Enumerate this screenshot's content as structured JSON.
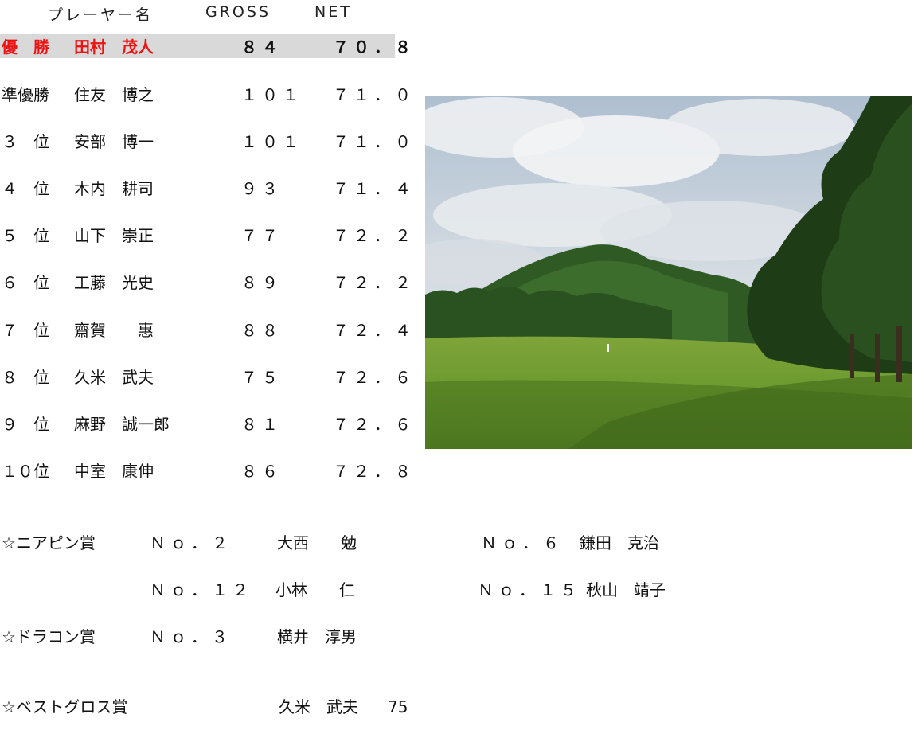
{
  "header": {
    "player": "プレーヤー名",
    "gross": "GROSS",
    "net": "NET"
  },
  "standings": [
    {
      "rank": "優　勝",
      "name": "田村　茂人",
      "gross": "８４",
      "net": "７０．８"
    },
    {
      "rank": "準優勝",
      "name": "住友　博之",
      "gross": "１０１",
      "net": "７１．０"
    },
    {
      "rank": "３　位",
      "name": "安部　博一",
      "gross": "１０１",
      "net": "７１．０"
    },
    {
      "rank": "４　位",
      "name": "木内　耕司",
      "gross": "９３",
      "net": "７１．４"
    },
    {
      "rank": "５　位",
      "name": "山下　崇正",
      "gross": "７７",
      "net": "７２．２"
    },
    {
      "rank": "６　位",
      "name": "工藤　光史",
      "gross": "８９",
      "net": "７２．２"
    },
    {
      "rank": "７　位",
      "name": "齋賀　　惠",
      "gross": "８８",
      "net": "７２．４"
    },
    {
      "rank": "８　位",
      "name": "久米　武夫",
      "gross": "７５",
      "net": "７２．６"
    },
    {
      "rank": "９　位",
      "name": "麻野　誠一郎",
      "gross": "８１",
      "net": "７２．６"
    },
    {
      "rank": "１０位",
      "name": "中室　康伸",
      "gross": "８６",
      "net": "７２．８"
    }
  ],
  "awards": {
    "nearpin": {
      "label": "☆ニアピン賞",
      "entries": [
        {
          "hole": "Ｎｏ．２",
          "name": "大西　　勉"
        },
        {
          "hole": "Ｎｏ．６",
          "name": "鎌田　克治"
        },
        {
          "hole": "Ｎｏ．１２",
          "name": "小林　　仁"
        },
        {
          "hole": "Ｎｏ．１５",
          "name": "秋山　靖子"
        }
      ]
    },
    "dracon": {
      "label": "☆ドラコン賞",
      "hole": "Ｎｏ．３",
      "name": "横井　淳男"
    },
    "bestgross": {
      "label": "☆ベストグロス賞",
      "name": "久米　武夫",
      "score": "75"
    }
  },
  "photo": {
    "subject": "golf-course-photo"
  },
  "colors": {
    "winner_text": "#ee1111",
    "winner_row_bg": "#d9d9d9"
  }
}
